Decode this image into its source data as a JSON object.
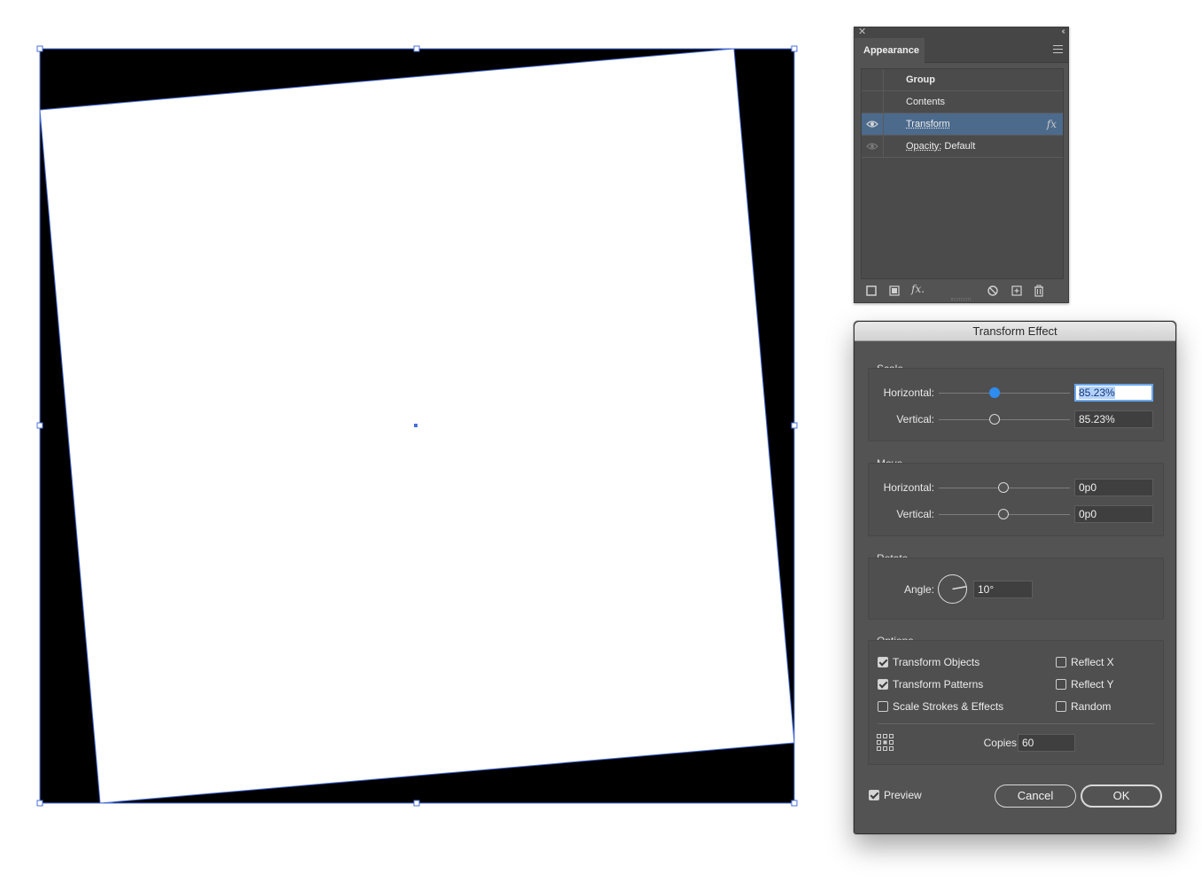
{
  "appearance_panel": {
    "tab_title": "Appearance",
    "rows": [
      {
        "label": "Group",
        "bold": true
      },
      {
        "label": "Contents",
        "bold": false
      },
      {
        "label": "Transform",
        "bold": false,
        "fx": "fx"
      },
      {
        "label_key": "Opacity:",
        "label_value": "Default"
      }
    ],
    "footer_icons": [
      "new-stroke-icon",
      "new-fill-icon",
      "add-effect-icon",
      "clear-appearance-icon",
      "duplicate-item-icon",
      "delete-item-icon"
    ],
    "fx_button_label": "fx."
  },
  "dialog": {
    "title": "Transform Effect",
    "scale": {
      "group_title": "Scale",
      "horizontal_label": "Horizontal:",
      "horizontal_value": "85.23%",
      "horizontal_slider_fraction": 0.43,
      "vertical_label": "Vertical:",
      "vertical_value": "85.23%",
      "vertical_slider_fraction": 0.43
    },
    "move": {
      "group_title": "Move",
      "horizontal_label": "Horizontal:",
      "horizontal_value": "0p0",
      "vertical_label": "Vertical:",
      "vertical_value": "0p0"
    },
    "rotate": {
      "group_title": "Rotate",
      "angle_label": "Angle:",
      "angle_value": "10°"
    },
    "options": {
      "group_title": "Options",
      "transform_objects": {
        "label": "Transform Objects",
        "checked": true
      },
      "transform_patterns": {
        "label": "Transform Patterns",
        "checked": true
      },
      "scale_strokes": {
        "label": "Scale Strokes & Effects",
        "checked": false
      },
      "reflect_x": {
        "label": "Reflect X",
        "checked": false
      },
      "reflect_y": {
        "label": "Reflect Y",
        "checked": false
      },
      "random": {
        "label": "Random",
        "checked": false
      },
      "copies_label": "Copies",
      "copies_value": "60"
    },
    "preview": {
      "label": "Preview",
      "checked": true
    },
    "cancel_label": "Cancel",
    "ok_label": "OK"
  },
  "colors": {
    "selection": "#4a6fd8",
    "panel_bg": "#535353",
    "highlight_row": "#4b6a8c",
    "slider_active": "#2f8cf0"
  }
}
